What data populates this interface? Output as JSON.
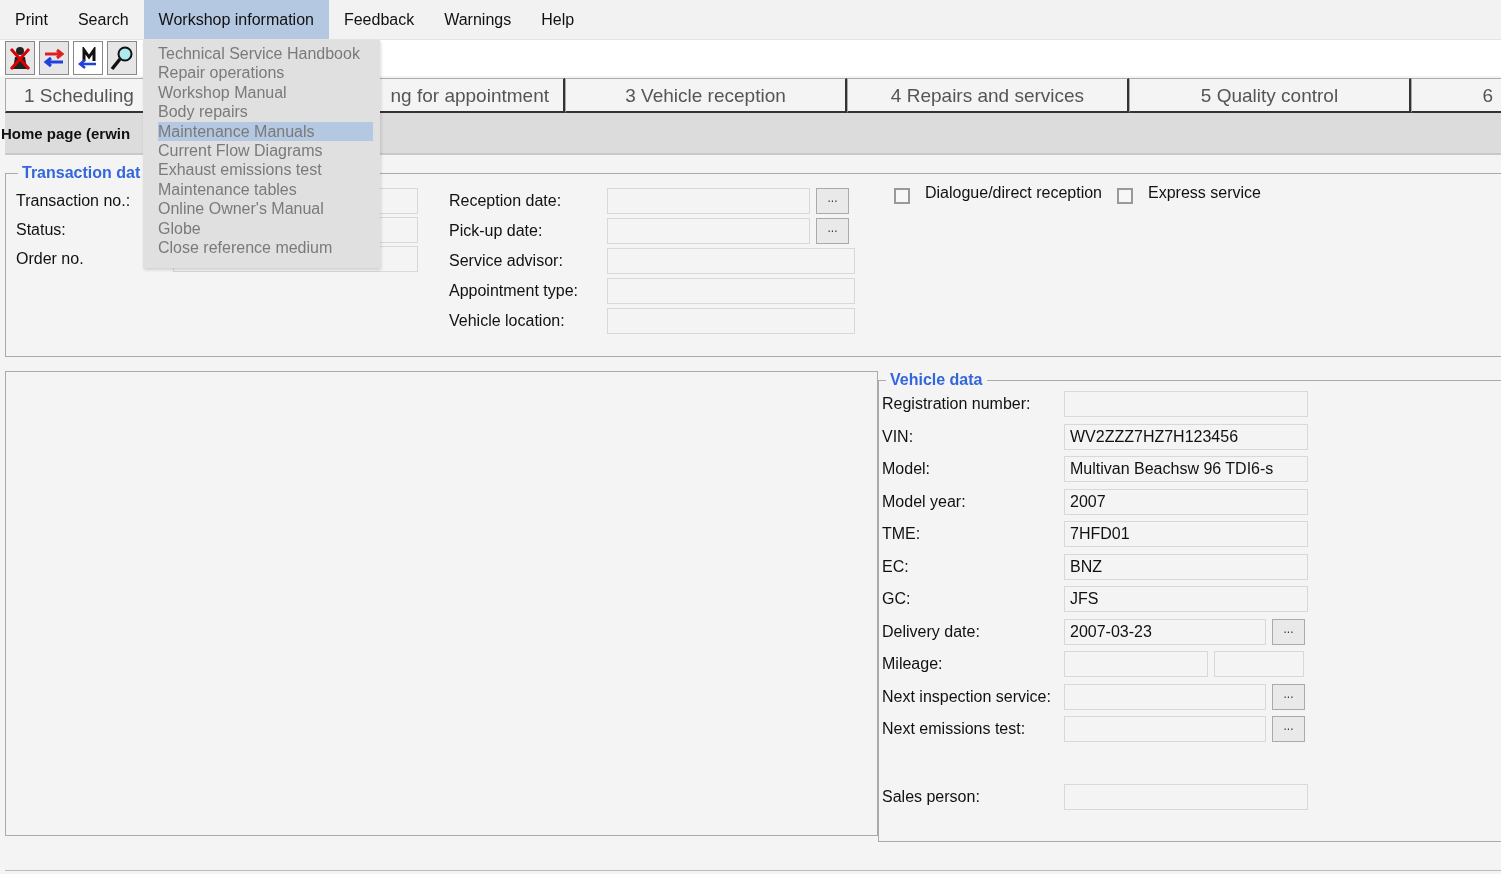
{
  "menu_bar": [
    {
      "label": "Print",
      "selected": false
    },
    {
      "label": "Search",
      "selected": false
    },
    {
      "label": "Workshop information",
      "selected": true
    },
    {
      "label": "Feedback",
      "selected": false
    },
    {
      "label": "Warnings",
      "selected": false
    },
    {
      "label": "Help",
      "selected": false
    }
  ],
  "dropdown": [
    {
      "label": "Technical Service Handbook",
      "selected": false
    },
    {
      "label": "Repair operations",
      "selected": false
    },
    {
      "label": "Workshop Manual",
      "selected": false
    },
    {
      "label": "Body repairs",
      "selected": false
    },
    {
      "label": "Maintenance Manuals",
      "selected": true
    },
    {
      "label": "Current Flow Diagrams",
      "selected": false
    },
    {
      "label": "Exhaust emissions test",
      "selected": false
    },
    {
      "label": "Maintenance tables",
      "selected": false
    },
    {
      "label": "Online Owner's Manual",
      "selected": false
    },
    {
      "label": "Globe",
      "selected": false
    },
    {
      "label": "Close reference medium",
      "selected": false
    }
  ],
  "tabs": [
    {
      "label": "1 Scheduling"
    },
    {
      "label": "ng for appointment"
    },
    {
      "label": "3 Vehicle reception"
    },
    {
      "label": "4 Repairs and services"
    },
    {
      "label": "5 Quality control"
    },
    {
      "label": "6"
    }
  ],
  "page_header": {
    "title": "Home page (erwin"
  },
  "transaction_data": {
    "title": "Transaction dat",
    "fields": [
      {
        "label": "Transaction no.:",
        "kind": "text"
      },
      {
        "label": "Status:",
        "kind": "text"
      },
      {
        "label": "Order no.",
        "kind": "text"
      }
    ],
    "reception_fields": [
      {
        "label": "Reception date:",
        "kind": "date",
        "button": "..."
      },
      {
        "label": "Pick-up date:",
        "kind": "date",
        "button": "..."
      },
      {
        "label": "Service advisor:",
        "kind": "text"
      },
      {
        "label": "Appointment type:",
        "kind": "text"
      },
      {
        "label": "Vehicle location:",
        "kind": "text"
      }
    ],
    "checkboxes": [
      {
        "label": "Dialogue/direct reception",
        "checked": false
      },
      {
        "label": "Express service",
        "checked": false
      }
    ]
  },
  "vehicle_data": {
    "title": "Vehicle data",
    "fields": [
      {
        "label": "Registration number:",
        "kind": "text"
      },
      {
        "label": "VIN:",
        "kind": "text",
        "value": "WV2ZZZ7HZ7H123456"
      },
      {
        "label": "Model:",
        "kind": "text",
        "value": "Multivan Beachsw 96 TDI6-s"
      },
      {
        "label": "Model year:",
        "kind": "text",
        "value": "2007"
      },
      {
        "label": "TME:",
        "kind": "text",
        "value": "7HFD01"
      },
      {
        "label": "EC:",
        "kind": "text",
        "value": "BNZ"
      },
      {
        "label": "GC:",
        "kind": "text",
        "value": "JFS"
      },
      {
        "label": "Delivery date:",
        "kind": "date",
        "value": "2007-03-23",
        "button": "..."
      },
      {
        "label": "Mileage:",
        "kind": "double"
      },
      {
        "label": "Next inspection service:",
        "kind": "date",
        "button": "..."
      },
      {
        "label": "Next emissions test:",
        "kind": "date",
        "button": "..."
      },
      {
        "label": "Sales person:",
        "kind": "text",
        "gap": true
      }
    ]
  }
}
